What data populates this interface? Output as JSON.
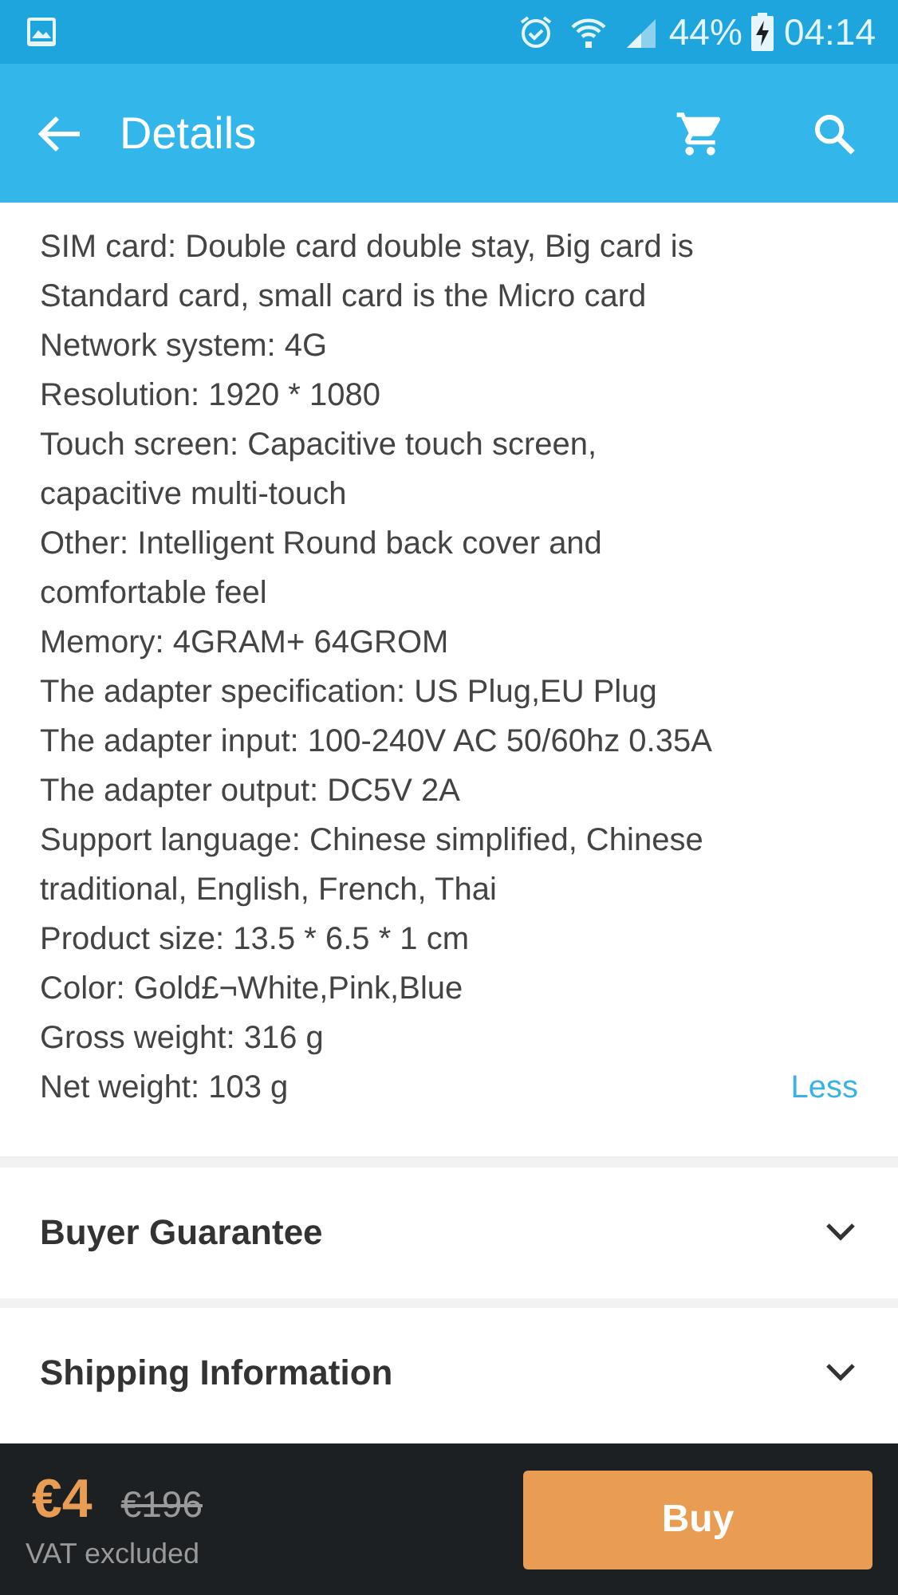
{
  "status_bar": {
    "battery": "44%",
    "time": "04:14"
  },
  "toolbar": {
    "title": "Details"
  },
  "specs": {
    "lines": [
      "SIM card: Double card double stay, Big card is Standard card, small card is the Micro card",
      "Network system: 4G",
      "Resolution: 1920 * 1080",
      "Touch screen: Capacitive touch screen, capacitive multi-touch",
      "Other: Intelligent Round back cover and comfortable feel",
      "Memory: 4GRAM+ 64GROM",
      "The adapter specification: US Plug,EU Plug",
      "The adapter input: 100-240V AC 50/60hz 0.35A",
      "The adapter output: DC5V 2A",
      "Support language: Chinese simplified, Chinese traditional, English, French, Thai",
      "Product size: 13.5 * 6.5 * 1 cm",
      "Color: Gold£¬White,Pink,Blue",
      "Gross weight: 316 g",
      "Net weight: 103 g"
    ],
    "toggle": "Less"
  },
  "sections": [
    {
      "title": "Buyer Guarantee",
      "expanded": false
    },
    {
      "title": "Shipping Information",
      "expanded": false
    }
  ],
  "buy_bar": {
    "price": "€4",
    "original_price": "€196",
    "note": "VAT excluded",
    "button": "Buy"
  }
}
